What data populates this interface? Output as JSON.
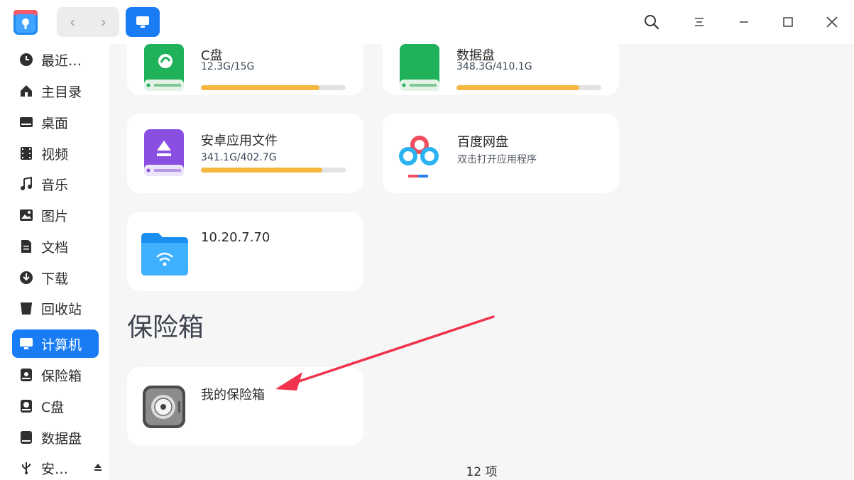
{
  "titlebar": {
    "back": "‹",
    "forward": "›"
  },
  "sidebar": {
    "items": [
      {
        "label": "最近…",
        "icon": "clock-icon"
      },
      {
        "label": "主目录",
        "icon": "home-icon"
      },
      {
        "label": "桌面",
        "icon": "desktop-icon"
      },
      {
        "label": "视频",
        "icon": "video-icon"
      },
      {
        "label": "音乐",
        "icon": "music-icon"
      },
      {
        "label": "图片",
        "icon": "image-icon"
      },
      {
        "label": "文档",
        "icon": "document-icon"
      },
      {
        "label": "下载",
        "icon": "download-icon"
      },
      {
        "label": "回收站",
        "icon": "trash-icon"
      },
      {
        "label": "计算机",
        "icon": "computer-icon",
        "active": true
      },
      {
        "label": "保险箱",
        "icon": "vault-icon"
      },
      {
        "label": "C盘",
        "icon": "disk-icon"
      },
      {
        "label": "数据盘",
        "icon": "disk-icon"
      },
      {
        "label": "安…",
        "icon": "usb-icon"
      }
    ]
  },
  "drives": {
    "c_drive": {
      "title": "C盘",
      "usage": "12.3G/15G",
      "fill": 0.82
    },
    "data_drive": {
      "title": "数据盘",
      "usage": "348.3G/410.1G",
      "fill": 0.85
    },
    "android_files": {
      "title": "安卓应用文件",
      "usage": "341.1G/402.7G",
      "fill": 0.84
    },
    "baidu": {
      "title": "百度网盘",
      "subtitle": "双击打开应用程序"
    },
    "network": {
      "title": "10.20.7.70"
    }
  },
  "vault_section": {
    "title": "保险箱",
    "my_vault": "我的保险箱"
  },
  "status": {
    "count": "12 项"
  },
  "colors": {
    "accent": "#1a7cf5",
    "progress": "#f4b840",
    "annotation_arrow": "#f0324f"
  }
}
